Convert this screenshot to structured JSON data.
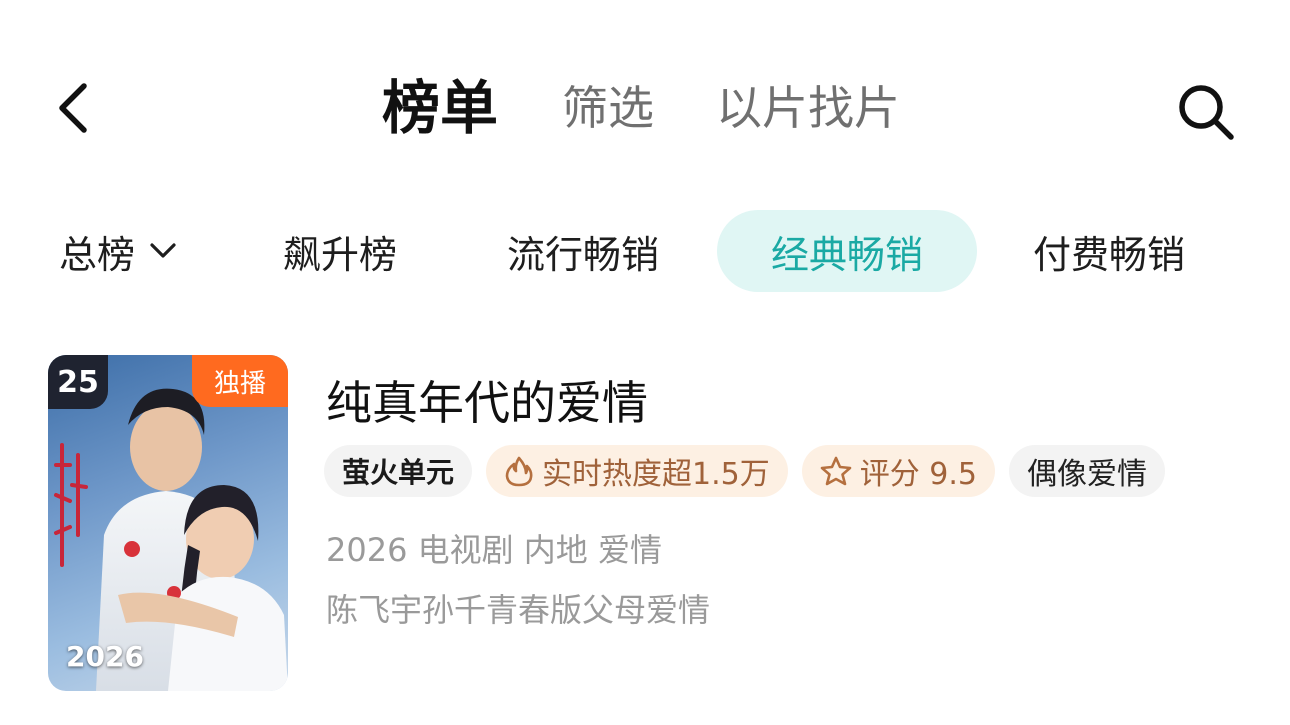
{
  "nav": {
    "back_icon": "chevron-left-icon",
    "tabs": [
      {
        "label": "榜单",
        "active": true
      },
      {
        "label": "筛选",
        "active": false
      },
      {
        "label": "以片找片",
        "active": false
      }
    ],
    "search_icon": "search-icon"
  },
  "subtabs": [
    {
      "label": "总榜",
      "dropdown": true,
      "active": false
    },
    {
      "label": "飙升榜",
      "active": false
    },
    {
      "label": "流行畅销",
      "active": false
    },
    {
      "label": "经典畅销",
      "active": true
    },
    {
      "label": "付费畅销",
      "active": false
    }
  ],
  "colors": {
    "accent": "#1aa9a4",
    "accent_bg": "#e0f6f4",
    "exclusive_badge": "#ff6a1f",
    "heat_tag_bg": "#fdf0e3",
    "heat_tag_text": "#a0623a"
  },
  "item": {
    "rank": "25",
    "exclusive_badge": "独播",
    "poster_year": "2026",
    "poster_icon": "drama-poster-image",
    "title": "纯真年代的爱情",
    "tags": {
      "brand": "萤火单元",
      "heat": "实时热度超1.5万",
      "heat_icon": "flame-icon",
      "rating": "评分 9.5",
      "rating_icon": "star-outline-icon",
      "genre": "偶像爱情"
    },
    "meta_line": "2026 电视剧 内地 爱情",
    "description": "陈飞宇孙千青春版父母爱情"
  }
}
